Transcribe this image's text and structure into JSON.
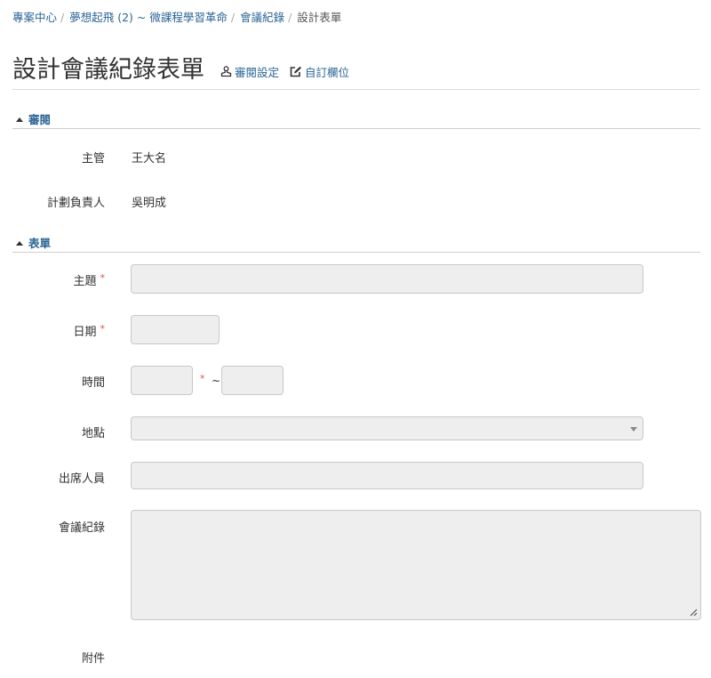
{
  "breadcrumb": {
    "items": [
      "專案中心",
      "夢想起飛 (2) ~ 微課程學習革命",
      "會議紀錄"
    ],
    "current": "設計表單",
    "separator": "/"
  },
  "page": {
    "title": "設計會議紀錄表單",
    "review_settings_label": "審閱設定",
    "custom_fields_label": "自訂欄位"
  },
  "sections": {
    "review": {
      "title": "審閱",
      "rows": [
        {
          "label": "主管",
          "value": "王大名"
        },
        {
          "label": "計劃負責人",
          "value": "吳明成"
        }
      ]
    },
    "form": {
      "title": "表單",
      "subject_label": "主題",
      "date_label": "日期",
      "time_label": "時間",
      "time_separator": "~",
      "location_label": "地點",
      "attendees_label": "出席人員",
      "minutes_label": "會議紀錄",
      "attachments_label": "附件",
      "required_mark": "*"
    }
  },
  "colors": {
    "link": "#2a6496",
    "required": "#d9534f",
    "field_bg": "#eeeeee"
  }
}
